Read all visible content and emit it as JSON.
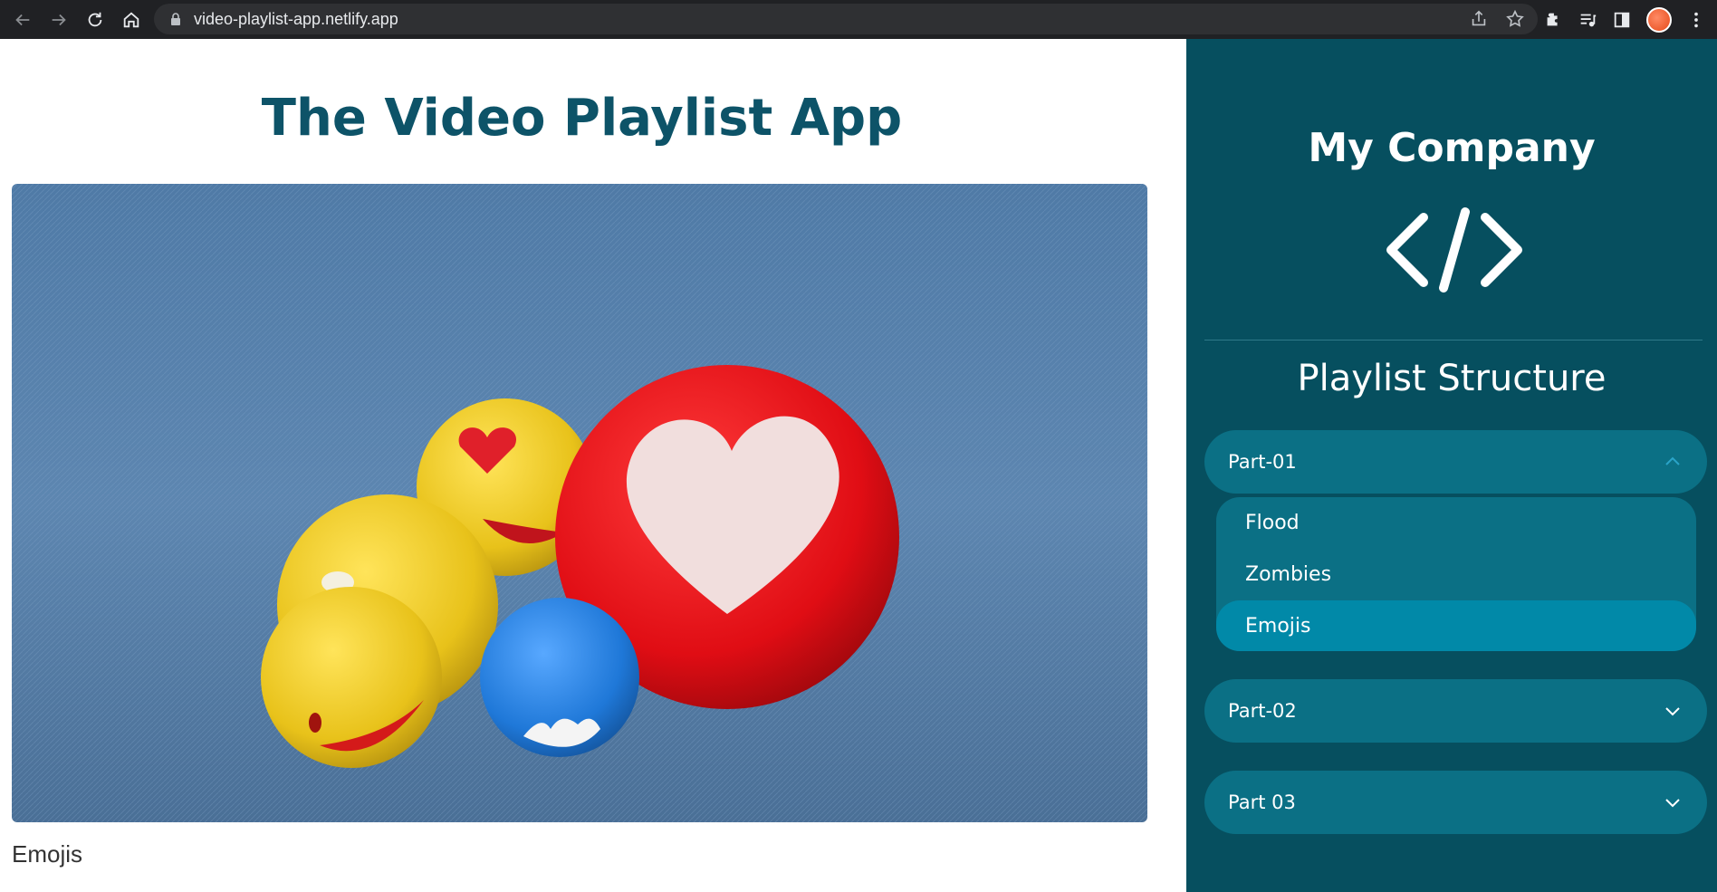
{
  "browser": {
    "url": "video-playlist-app.netlify.app"
  },
  "page": {
    "title": "The Video Playlist App",
    "video_caption": "Emojis"
  },
  "sidebar": {
    "company": "My Company",
    "structure_title": "Playlist Structure",
    "sections": [
      {
        "label": "Part-01",
        "expanded": true,
        "items": [
          "Flood",
          "Zombies",
          "Emojis"
        ],
        "active_item": "Emojis"
      },
      {
        "label": "Part-02",
        "expanded": false
      },
      {
        "label": "Part 03",
        "expanded": false
      }
    ]
  },
  "colors": {
    "sidebar_bg": "#064f5f",
    "accordion_bg": "#0b7085",
    "active_item_bg": "#0189a8",
    "title_color": "#0d5368"
  }
}
